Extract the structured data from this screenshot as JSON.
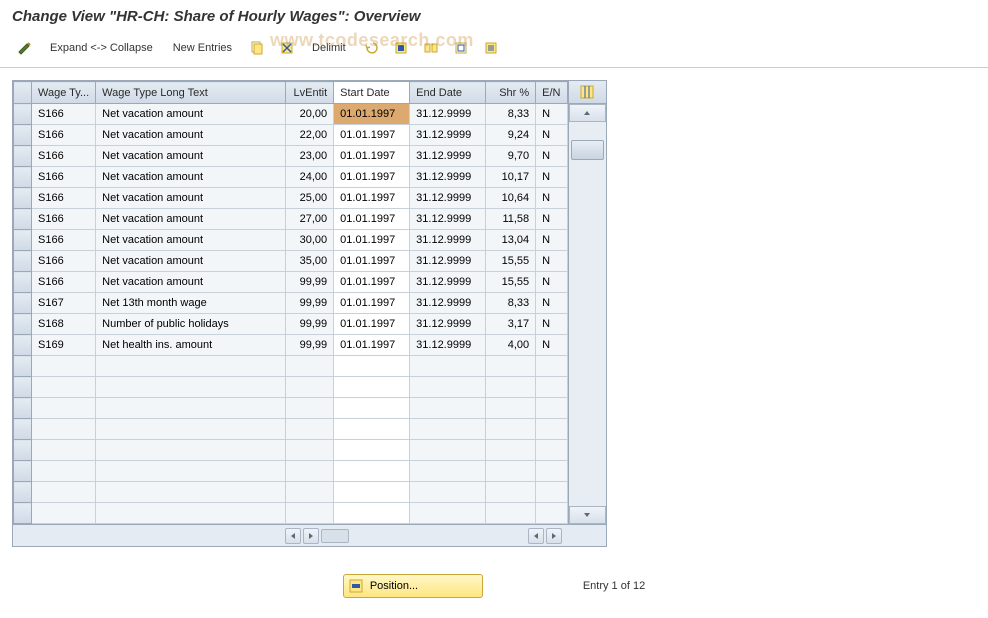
{
  "title": "Change View \"HR-CH: Share of Hourly Wages\": Overview",
  "toolbar": {
    "expand_collapse": "Expand <-> Collapse",
    "new_entries": "New Entries",
    "delimit": "Delimit"
  },
  "table": {
    "headers": {
      "wage_type": "Wage Ty...",
      "long_text": "Wage Type Long Text",
      "lventit": "LvEntit",
      "start_date": "Start Date",
      "end_date": "End Date",
      "shr": "Shr %",
      "en": "E/N"
    },
    "rows": [
      {
        "wt": "S166",
        "lt": "Net vacation amount",
        "lv": "20,00",
        "sd": "01.01.1997",
        "ed": "31.12.9999",
        "sh": "8,33",
        "en": "N"
      },
      {
        "wt": "S166",
        "lt": "Net vacation amount",
        "lv": "22,00",
        "sd": "01.01.1997",
        "ed": "31.12.9999",
        "sh": "9,24",
        "en": "N"
      },
      {
        "wt": "S166",
        "lt": "Net vacation amount",
        "lv": "23,00",
        "sd": "01.01.1997",
        "ed": "31.12.9999",
        "sh": "9,70",
        "en": "N"
      },
      {
        "wt": "S166",
        "lt": "Net vacation amount",
        "lv": "24,00",
        "sd": "01.01.1997",
        "ed": "31.12.9999",
        "sh": "10,17",
        "en": "N"
      },
      {
        "wt": "S166",
        "lt": "Net vacation amount",
        "lv": "25,00",
        "sd": "01.01.1997",
        "ed": "31.12.9999",
        "sh": "10,64",
        "en": "N"
      },
      {
        "wt": "S166",
        "lt": "Net vacation amount",
        "lv": "27,00",
        "sd": "01.01.1997",
        "ed": "31.12.9999",
        "sh": "11,58",
        "en": "N"
      },
      {
        "wt": "S166",
        "lt": "Net vacation amount",
        "lv": "30,00",
        "sd": "01.01.1997",
        "ed": "31.12.9999",
        "sh": "13,04",
        "en": "N"
      },
      {
        "wt": "S166",
        "lt": "Net vacation amount",
        "lv": "35,00",
        "sd": "01.01.1997",
        "ed": "31.12.9999",
        "sh": "15,55",
        "en": "N"
      },
      {
        "wt": "S166",
        "lt": "Net vacation amount",
        "lv": "99,99",
        "sd": "01.01.1997",
        "ed": "31.12.9999",
        "sh": "15,55",
        "en": "N"
      },
      {
        "wt": "S167",
        "lt": "Net 13th month wage",
        "lv": "99,99",
        "sd": "01.01.1997",
        "ed": "31.12.9999",
        "sh": "8,33",
        "en": "N"
      },
      {
        "wt": "S168",
        "lt": "Number of public holidays",
        "lv": "99,99",
        "sd": "01.01.1997",
        "ed": "31.12.9999",
        "sh": "3,17",
        "en": "N"
      },
      {
        "wt": "S169",
        "lt": "Net health ins. amount",
        "lv": "99,99",
        "sd": "01.01.1997",
        "ed": "31.12.9999",
        "sh": "4,00",
        "en": "N"
      }
    ],
    "empty_rows": 8
  },
  "footer": {
    "position_label": "Position...",
    "entry_text": "Entry 1 of 12"
  },
  "watermark": "www.tcodesearch.com"
}
